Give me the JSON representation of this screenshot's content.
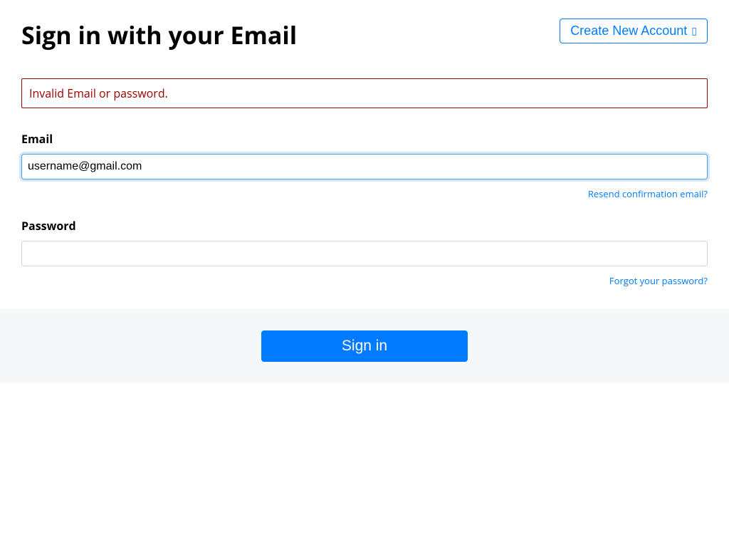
{
  "header": {
    "title": "Sign in with your Email",
    "create_account_label": "Create New Account"
  },
  "alert": {
    "message": "Invalid Email or password."
  },
  "form": {
    "email": {
      "label": "Email",
      "value": "username@gmail.com",
      "resend_link": "Resend confirmation email?"
    },
    "password": {
      "label": "Password",
      "value": "",
      "forgot_link": "Forgot your password?"
    }
  },
  "actions": {
    "signin_label": "Sign in"
  }
}
